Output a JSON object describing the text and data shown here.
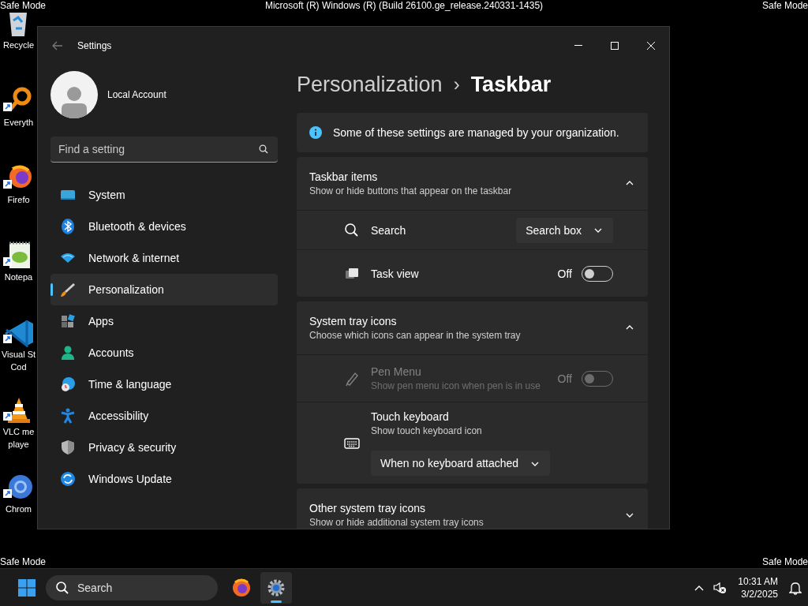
{
  "overlay_texts": {
    "top_left": "Safe Mode",
    "top_center": "Microsoft (R) Windows (R) (Build 26100.ge_release.240331-1435)",
    "top_right": "Safe Mode",
    "bottom_left": "Safe Mode",
    "bottom_right": "Safe Mode"
  },
  "desktop_icons": [
    {
      "kind": "recycle",
      "label_lines": [
        "Recycle"
      ]
    },
    {
      "kind": "magnifier",
      "label_lines": [
        "Everyth"
      ]
    },
    {
      "kind": "firefox",
      "label_lines": [
        "Firefo"
      ]
    },
    {
      "kind": "notepad",
      "label_lines": [
        "Notepa"
      ]
    },
    {
      "kind": "vscode",
      "label_lines": [
        "Visual St",
        "Cod"
      ]
    },
    {
      "kind": "vlc",
      "label_lines": [
        "VLC me",
        "playe"
      ]
    },
    {
      "kind": "chrome",
      "label_lines": [
        "Chrom"
      ]
    }
  ],
  "window": {
    "title": "Settings",
    "account": {
      "name": "Local Account"
    },
    "search": {
      "placeholder": "Find a setting"
    },
    "sidebar": {
      "items": [
        {
          "label": "System",
          "selected": false
        },
        {
          "label": "Bluetooth & devices",
          "selected": false
        },
        {
          "label": "Network & internet",
          "selected": false
        },
        {
          "label": "Personalization",
          "selected": true
        },
        {
          "label": "Apps",
          "selected": false
        },
        {
          "label": "Accounts",
          "selected": false
        },
        {
          "label": "Time & language",
          "selected": false
        },
        {
          "label": "Accessibility",
          "selected": false
        },
        {
          "label": "Privacy & security",
          "selected": false
        },
        {
          "label": "Windows Update",
          "selected": false
        }
      ]
    },
    "breadcrumb": {
      "parent": "Personalization",
      "separator": "›",
      "current": "Taskbar"
    },
    "notice": "Some of these settings are managed by your organization.",
    "sections": [
      {
        "title": "Taskbar items",
        "subtitle": "Show or hide buttons that appear on the taskbar",
        "expanded": true,
        "rows": [
          {
            "kind": "dropdown",
            "label": "Search",
            "value": "Search box",
            "disabled": false
          },
          {
            "kind": "toggle",
            "label": "Task view",
            "state_text": "Off",
            "on": false,
            "disabled": false
          }
        ]
      },
      {
        "title": "System tray icons",
        "subtitle": "Choose which icons can appear in the system tray",
        "expanded": true,
        "rows": [
          {
            "kind": "toggle",
            "label": "Pen Menu",
            "description": "Show pen menu icon when pen is in use",
            "state_text": "Off",
            "on": false,
            "disabled": true
          },
          {
            "kind": "dropdown_below",
            "label": "Touch keyboard",
            "description": "Show touch keyboard icon",
            "value": "When no keyboard attached",
            "disabled": false
          }
        ]
      },
      {
        "title": "Other system tray icons",
        "subtitle": "Show or hide additional system tray icons",
        "expanded": false
      }
    ]
  },
  "taskbar": {
    "search": {
      "placeholder": "Search"
    },
    "apps": [
      {
        "kind": "firefox",
        "selected": false
      },
      {
        "kind": "settings",
        "selected": true
      }
    ],
    "clock": {
      "time": "10:31 AM",
      "date": "3/2/2025"
    }
  }
}
